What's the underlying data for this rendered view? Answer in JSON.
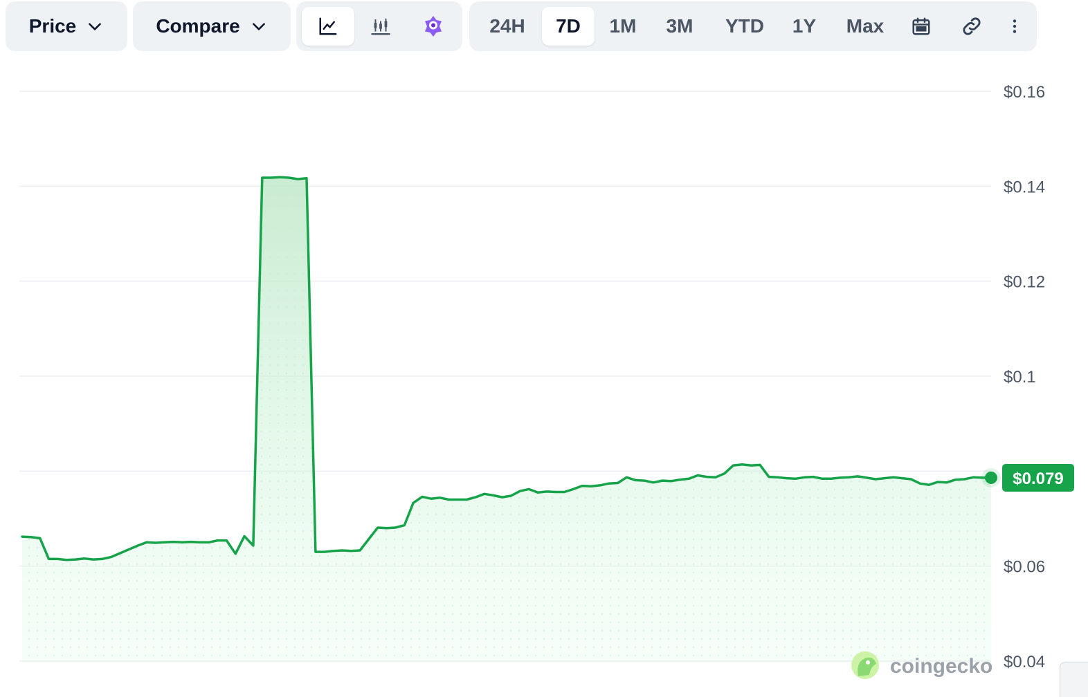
{
  "toolbar": {
    "price_label": "Price",
    "compare_label": "Compare",
    "chart_type_icons": [
      "line-chart-icon",
      "candlestick-chart-icon",
      "ai-assistant-icon"
    ],
    "ranges": [
      "24H",
      "7D",
      "1M",
      "3M",
      "YTD",
      "1Y",
      "Max"
    ],
    "active_range": "7D",
    "extra_icons": [
      "calendar-icon",
      "link-icon",
      "more-vertical-icon"
    ]
  },
  "colors": {
    "line": "#16a34a",
    "fill": "#dcfce7",
    "label_bg": "#16a34a",
    "accent_purple": "#8b5cf6"
  },
  "watermark": {
    "text": "coingecko"
  },
  "current_price_label": "$0.079",
  "chart_data": {
    "type": "area",
    "title": "",
    "xlabel": "",
    "ylabel": "",
    "ylim": [
      0.04,
      0.16
    ],
    "y_ticks": [
      "$0.16",
      "$0.14",
      "$0.12",
      "$0.1",
      "$0.06",
      "$0.04"
    ],
    "y_tick_values": [
      0.16,
      0.14,
      0.12,
      0.1,
      0.06,
      0.04
    ],
    "x_axis_labels": [],
    "grid": true,
    "legend": "none",
    "series": [
      {
        "values": [
          0.0662,
          0.0661,
          0.0659,
          0.0615,
          0.0615,
          0.0613,
          0.0614,
          0.0616,
          0.0614,
          0.0615,
          0.0619,
          0.0627,
          0.0635,
          0.0643,
          0.065,
          0.0649,
          0.065,
          0.0651,
          0.065,
          0.0651,
          0.065,
          0.065,
          0.0654,
          0.0654,
          0.0626,
          0.0663,
          0.0643,
          0.1418,
          0.1418,
          0.1419,
          0.1418,
          0.1415,
          0.1417,
          0.063,
          0.063,
          0.0632,
          0.0633,
          0.0632,
          0.0633,
          0.0657,
          0.0681,
          0.068,
          0.0681,
          0.0686,
          0.0733,
          0.0746,
          0.0742,
          0.0744,
          0.074,
          0.074,
          0.074,
          0.0745,
          0.0752,
          0.0749,
          0.0745,
          0.0748,
          0.0758,
          0.0762,
          0.0755,
          0.0757,
          0.0756,
          0.0756,
          0.0762,
          0.0769,
          0.0768,
          0.077,
          0.0774,
          0.0775,
          0.0787,
          0.0781,
          0.078,
          0.0776,
          0.078,
          0.0779,
          0.0782,
          0.0784,
          0.0791,
          0.0788,
          0.0787,
          0.0795,
          0.0812,
          0.0814,
          0.0812,
          0.0813,
          0.0788,
          0.0787,
          0.0785,
          0.0784,
          0.0787,
          0.0788,
          0.0784,
          0.0784,
          0.0786,
          0.0787,
          0.0789,
          0.0786,
          0.0783,
          0.0785,
          0.0787,
          0.0785,
          0.0783,
          0.0774,
          0.0771,
          0.0777,
          0.0776,
          0.0782,
          0.0783,
          0.0787,
          0.0786,
          0.0786
        ]
      }
    ]
  }
}
